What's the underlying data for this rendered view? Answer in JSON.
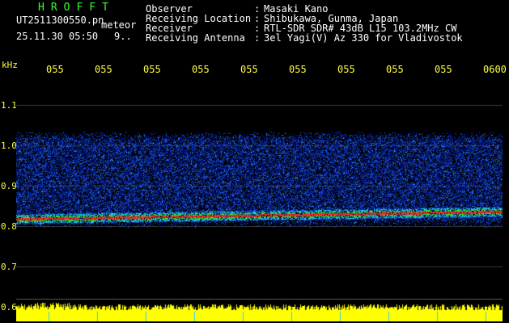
{
  "header": {
    "app_title": "HROFFT",
    "file_name": "UT2511300550.pn",
    "detect_label": "meteor",
    "datetime": "25.11.30 05:50",
    "count": "9.."
  },
  "info": {
    "rows": [
      {
        "label": "Observer",
        "value": "Masaki Kano"
      },
      {
        "label": "Receiving Location",
        "value": "Shibukawa, Gunma, Japan"
      },
      {
        "label": "Receiver",
        "value": "RTL-SDR SDR# 43dB L15 103.2MHz CW"
      },
      {
        "label": "Receiving Antenna",
        "value": "3el Yagi(V) Az 330 for Vladivostok"
      }
    ]
  },
  "axis": {
    "unit": "kHz",
    "time_labels": [
      "055",
      "055",
      "055",
      "055",
      "055",
      "055",
      "055",
      "055",
      "055",
      "0600"
    ],
    "freq_labels": [
      "1.1",
      "1.0",
      "0.9",
      "0.8",
      "0.7",
      "0.6"
    ]
  },
  "colors": {
    "background": "#000000",
    "title": "#33ff33",
    "labels": "#ffff44",
    "text": "#ffffff",
    "noise_low": "#0a1a8c",
    "noise_high": "#1e64ff",
    "carrier": "#ff2020"
  }
}
